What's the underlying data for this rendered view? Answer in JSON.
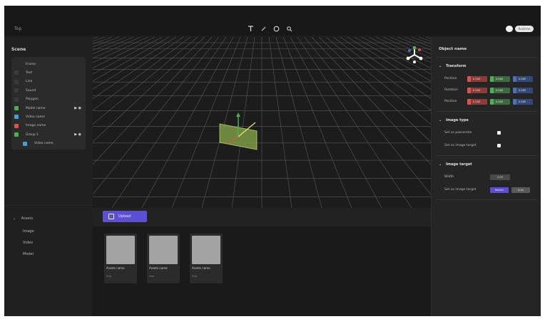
{
  "app": {
    "title": "Top",
    "mode_toggle_label": "Runtime"
  },
  "toolbar": {
    "tools": [
      {
        "icon": "text-tool-icon"
      },
      {
        "icon": "pen-tool-icon"
      },
      {
        "icon": "circle-tool-icon"
      },
      {
        "icon": "search-icon"
      }
    ]
  },
  "scene": {
    "title": "Scene",
    "items": [
      {
        "label": "Frame",
        "icon_color": "#2b2b2b"
      },
      {
        "label": "Text",
        "icon_color": "#3a3a3a"
      },
      {
        "label": "Line",
        "icon_color": "#3a3a3a"
      },
      {
        "label": "Sound",
        "icon_color": "#3a3a3a"
      },
      {
        "label": "Polygon",
        "icon_color": "#3a3a3a"
      },
      {
        "label": "Model name",
        "icon_color": "#4caf50",
        "controls": "▶ ◉"
      },
      {
        "label": "Video name",
        "icon_color": "#46a0d6"
      },
      {
        "label": "Image name",
        "icon_color": "#d9534f"
      },
      {
        "label": "Group 1",
        "icon_color": "#4caf50",
        "controls": "▶ ◉"
      },
      {
        "label": "Video name",
        "icon_color": "#46a0d6"
      }
    ]
  },
  "assets": {
    "title": "Assets",
    "items": [
      "Image",
      "Video",
      "Model"
    ]
  },
  "bottom": {
    "upload_label": "Upload",
    "cards": [
      {
        "name": "Assets name",
        "sub": "Size"
      },
      {
        "name": "Assets name",
        "sub": "Size"
      },
      {
        "name": "Assets name",
        "sub": "Size"
      }
    ]
  },
  "inspector": {
    "title": "Object name",
    "transform": {
      "title": "Transform",
      "rows": [
        {
          "label": "Position",
          "x": "0.000",
          "y": "0.000",
          "z": "0.000"
        },
        {
          "label": "Rotation",
          "x": "0.000",
          "y": "0.000",
          "z": "0.000"
        },
        {
          "label": "Position",
          "x": "0.000",
          "y": "0.000",
          "z": "0.000"
        }
      ]
    },
    "image_type": {
      "title": "Image type",
      "options": [
        "Set as passerelle",
        "Set as image target"
      ]
    },
    "image_target": {
      "title": "Image target",
      "width_label": "Width",
      "width_value": "0.00",
      "set_target_label": "Set as image target",
      "button_primary": "Marker",
      "button_secondary": "Auto"
    }
  },
  "colors": {
    "x_axis": "#d9534f",
    "y_axis": "#4caf50",
    "z_axis": "#4a6fb5",
    "accent": "#5c4fd6"
  }
}
